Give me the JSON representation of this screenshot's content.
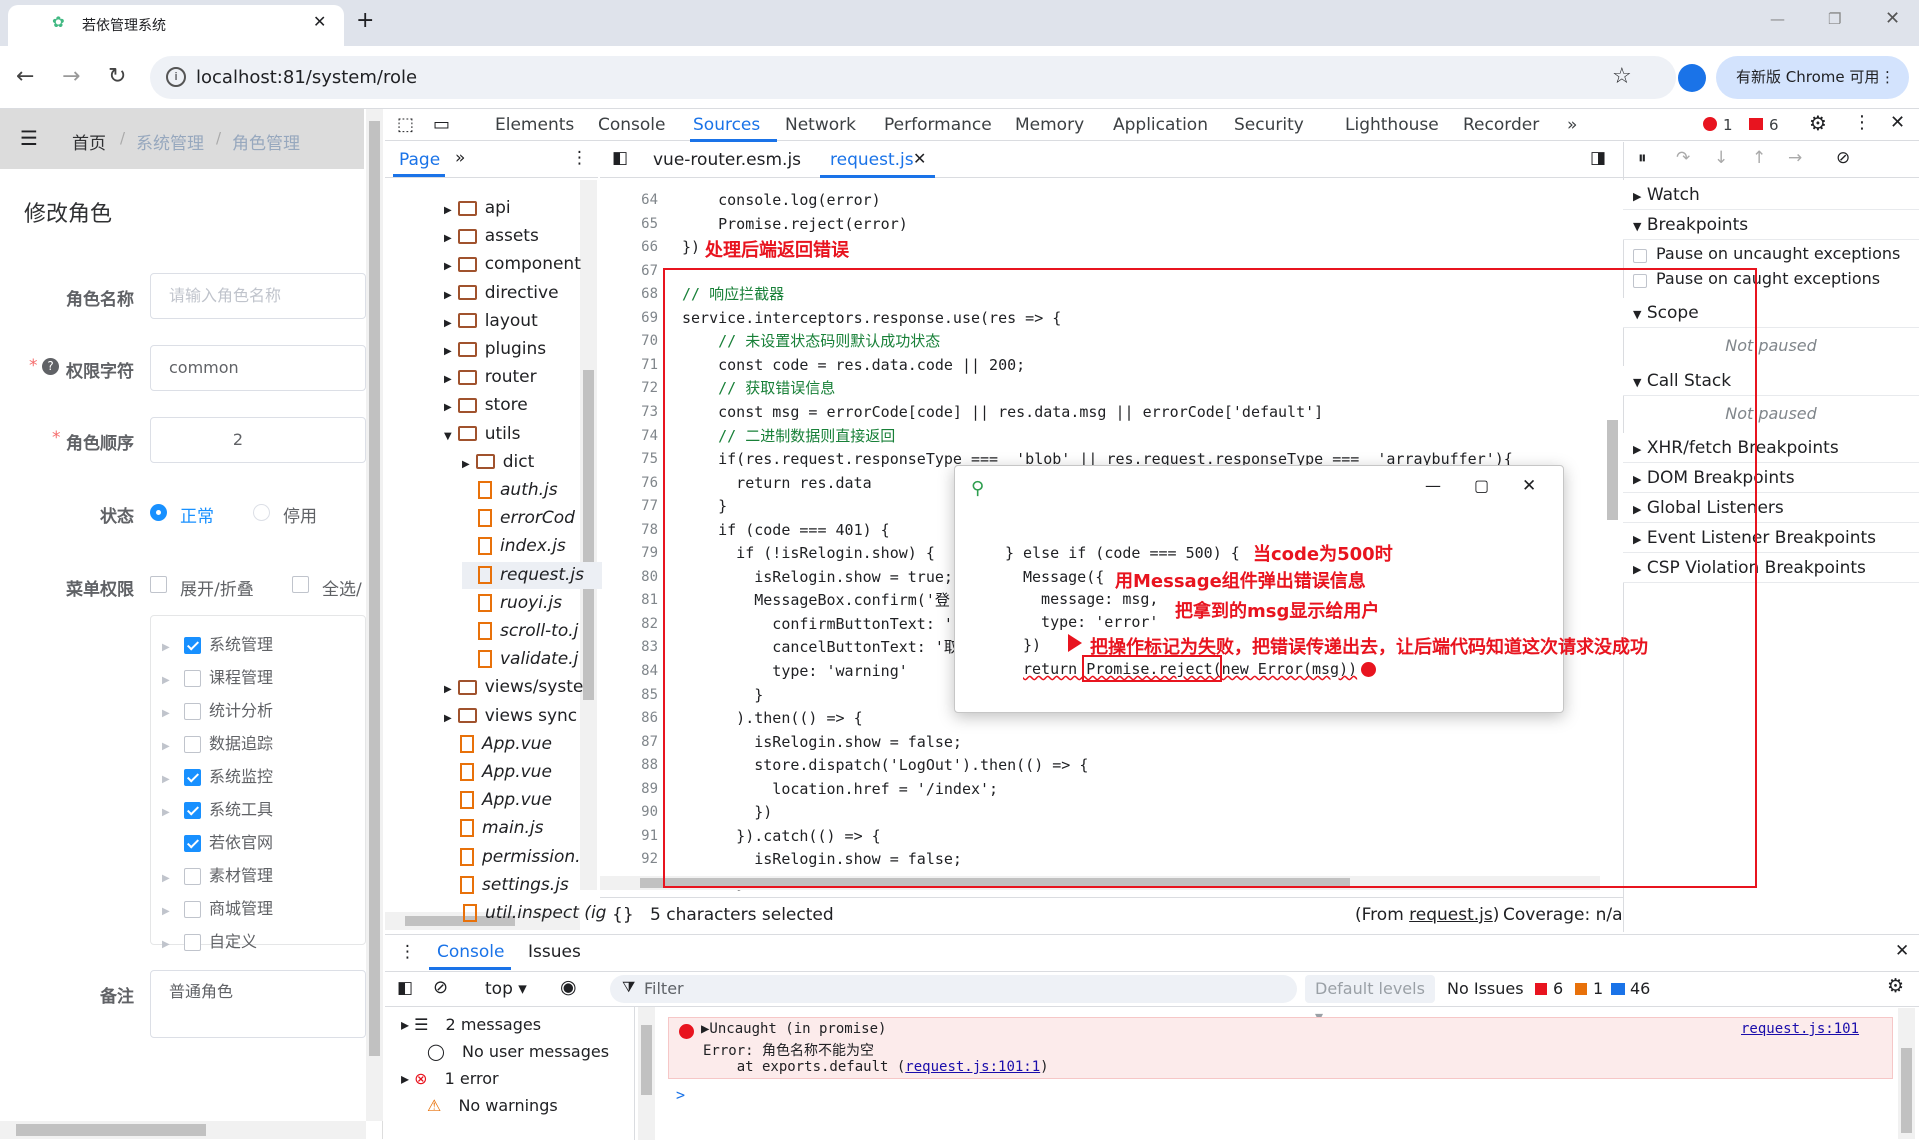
{
  "browser": {
    "tab_title": "若依管理系统",
    "url": "localhost:81/system/role",
    "update_label": "有新版 Chrome 可用"
  },
  "app": {
    "breadcrumb": [
      "首页",
      "系统管理",
      "角色管理"
    ],
    "sep": "/",
    "dialog_title": "修改角色",
    "fields": {
      "role_name_label": "角色名称",
      "role_name_placeholder": "请输入角色名称",
      "perm_label": "权限字符",
      "perm_value": "common",
      "order_label": "角色顺序",
      "order_value": "2",
      "status_label": "状态",
      "status_normal": "正常",
      "status_disabled": "停用",
      "menu_label": "菜单权限",
      "expand_label": "展开/折叠",
      "all_label": "全选/",
      "remark_label": "备注",
      "remark_value": "普通角色",
      "required_mark": "*"
    },
    "menu_tree": [
      {
        "label": "系统管理",
        "checked": true,
        "arrow": true
      },
      {
        "label": "课程管理",
        "checked": false,
        "arrow": true
      },
      {
        "label": "统计分析",
        "checked": false,
        "arrow": true
      },
      {
        "label": "数据追踪",
        "checked": false,
        "arrow": true
      },
      {
        "label": "系统监控",
        "checked": true,
        "arrow": true
      },
      {
        "label": "系统工具",
        "checked": true,
        "arrow": true
      },
      {
        "label": "若依官网",
        "checked": true,
        "arrow": false
      },
      {
        "label": "素材管理",
        "checked": false,
        "arrow": true
      },
      {
        "label": "商城管理",
        "checked": false,
        "arrow": true
      },
      {
        "label": "自定义",
        "checked": false,
        "arrow": true
      }
    ]
  },
  "devtools": {
    "tabs": [
      "Elements",
      "Console",
      "Sources",
      "Network",
      "Performance",
      "Memory",
      "Application",
      "Security",
      "Lighthouse",
      "Recorder"
    ],
    "error_count": "1",
    "warn_count": "6",
    "nav_tab": "Page",
    "file_tree": [
      {
        "name": "api",
        "type": "folder",
        "indent": 1
      },
      {
        "name": "assets",
        "type": "folder",
        "indent": 1
      },
      {
        "name": "component",
        "type": "folder",
        "indent": 1
      },
      {
        "name": "directive",
        "type": "folder",
        "indent": 1
      },
      {
        "name": "layout",
        "type": "folder",
        "indent": 1
      },
      {
        "name": "plugins",
        "type": "folder",
        "indent": 1
      },
      {
        "name": "router",
        "type": "folder",
        "indent": 1
      },
      {
        "name": "store",
        "type": "folder",
        "indent": 1
      },
      {
        "name": "utils",
        "type": "folder-open",
        "indent": 1
      },
      {
        "name": "dict",
        "type": "folder",
        "indent": 2
      },
      {
        "name": "auth.js",
        "type": "file",
        "indent": 2
      },
      {
        "name": "errorCod",
        "type": "file",
        "indent": 2
      },
      {
        "name": "index.js",
        "type": "file",
        "indent": 2
      },
      {
        "name": "request.js",
        "type": "file",
        "indent": 2,
        "selected": true
      },
      {
        "name": "ruoyi.js",
        "type": "file",
        "indent": 2
      },
      {
        "name": "scroll-to.j",
        "type": "file",
        "indent": 2
      },
      {
        "name": "validate.j",
        "type": "file",
        "indent": 2
      },
      {
        "name": "views/syste",
        "type": "folder",
        "indent": 1
      },
      {
        "name": "views sync",
        "type": "folder",
        "indent": 1
      },
      {
        "name": "App.vue",
        "type": "file",
        "indent": 1
      },
      {
        "name": "App.vue",
        "type": "file",
        "indent": 1
      },
      {
        "name": "App.vue",
        "type": "file",
        "indent": 1
      },
      {
        "name": "main.js",
        "type": "file",
        "indent": 1
      },
      {
        "name": "permission.",
        "type": "file",
        "indent": 1
      },
      {
        "name": "settings.js",
        "type": "file",
        "indent": 1
      },
      {
        "name": "util.inspect (ig",
        "type": "file",
        "indent": 0
      }
    ],
    "editor_tabs": [
      "vue-router.esm.js",
      "request.js"
    ],
    "code_lines": [
      {
        "n": "64",
        "t": "    console.log(error)"
      },
      {
        "n": "65",
        "t": "    Promise.reject(error)"
      },
      {
        "n": "66",
        "t": "})"
      },
      {
        "n": "67",
        "t": ""
      },
      {
        "n": "68",
        "t": "// 响应拦截器"
      },
      {
        "n": "69",
        "t": "service.interceptors.response.use(res => {"
      },
      {
        "n": "70",
        "t": "    // 未设置状态码则默认成功状态"
      },
      {
        "n": "71",
        "t": "    const code = res.data.code || 200;"
      },
      {
        "n": "72",
        "t": "    // 获取错误信息"
      },
      {
        "n": "73",
        "t": "    const msg = errorCode[code] || res.data.msg || errorCode['default']"
      },
      {
        "n": "74",
        "t": "    // 二进制数据则直接返回"
      },
      {
        "n": "75",
        "t": "    if(res.request.responseType ===  'blob' || res.request.responseType ===  'arraybuffer'){"
      },
      {
        "n": "76",
        "t": "      return res.data"
      },
      {
        "n": "77",
        "t": "    }"
      },
      {
        "n": "78",
        "t": "    if (code === 401) {"
      },
      {
        "n": "79",
        "t": "      if (!isRelogin.show) {"
      },
      {
        "n": "80",
        "t": "        isRelogin.show = true;"
      },
      {
        "n": "81",
        "t": "        MessageBox.confirm('登"
      },
      {
        "n": "82",
        "t": "          confirmButtonText: '"
      },
      {
        "n": "83",
        "t": "          cancelButtonText: '取"
      },
      {
        "n": "84",
        "t": "          type: 'warning'"
      },
      {
        "n": "85",
        "t": "        }"
      },
      {
        "n": "86",
        "t": "      ).then(() => {"
      },
      {
        "n": "87",
        "t": "        isRelogin.show = false;"
      },
      {
        "n": "88",
        "t": "        store.dispatch('LogOut').then(() => {"
      },
      {
        "n": "89",
        "t": "          location.href = '/index';"
      },
      {
        "n": "90",
        "t": "        })"
      },
      {
        "n": "91",
        "t": "      }).catch(() => {"
      },
      {
        "n": "92",
        "t": "        isRelogin.show = false;"
      },
      {
        "n": "93",
        "t": "      });"
      }
    ],
    "popup_lines": [
      "} else if (code === 500) {",
      "Message({",
      "  message: msg,",
      "  type: 'error'",
      "})",
      "return Promise.reject(new Error(msg))"
    ],
    "annotations": {
      "a1": "处理后端返回错误",
      "a2": "当code为500时",
      "a3": "用Message组件弹出错误信息",
      "a4": "把拿到的msg显示给用户",
      "a5": "把操作标记为失败，把错误传递出去，让后端代码知道这次请求没成功"
    },
    "right_panel": {
      "watch": "Watch",
      "breakpoints": "Breakpoints",
      "pause_uncaught": "Pause on uncaught exceptions",
      "pause_caught": "Pause on caught exceptions",
      "scope": "Scope",
      "not_paused": "Not paused",
      "call_stack": "Call Stack",
      "xhr": "XHR/fetch Breakpoints",
      "dom": "DOM Breakpoints",
      "global": "Global Listeners",
      "event": "Event Listener Breakpoints",
      "csp": "CSP Violation Breakpoints"
    },
    "status": {
      "selected": "5 characters selected",
      "from_prefix": "(From ",
      "from_file": "request.js",
      "from_suffix": ")",
      "coverage": "Coverage: n/a"
    },
    "console": {
      "tabs": [
        "Console",
        "Issues"
      ],
      "context": "top",
      "filter_placeholder": "Filter",
      "levels": "Default levels",
      "no_issues": "No Issues",
      "issues_err": "6",
      "issues_warn": "1",
      "issues_info": "46",
      "sidebar": [
        "2 messages",
        "No user messages",
        "1 error",
        "No warnings"
      ],
      "err_line1": "▶Uncaught (in promise)",
      "err_line2": "Error: 角色名称不能为空",
      "err_line3": "    at exports.default (",
      "err_link": "request.js:101:1",
      "err_line3_end": ")",
      "err_src": "request.js:101",
      "prompt": ">"
    }
  },
  "colors": {
    "accent": "#1a73e8",
    "error": "#e8141f",
    "element_blue": "#1890ff"
  }
}
